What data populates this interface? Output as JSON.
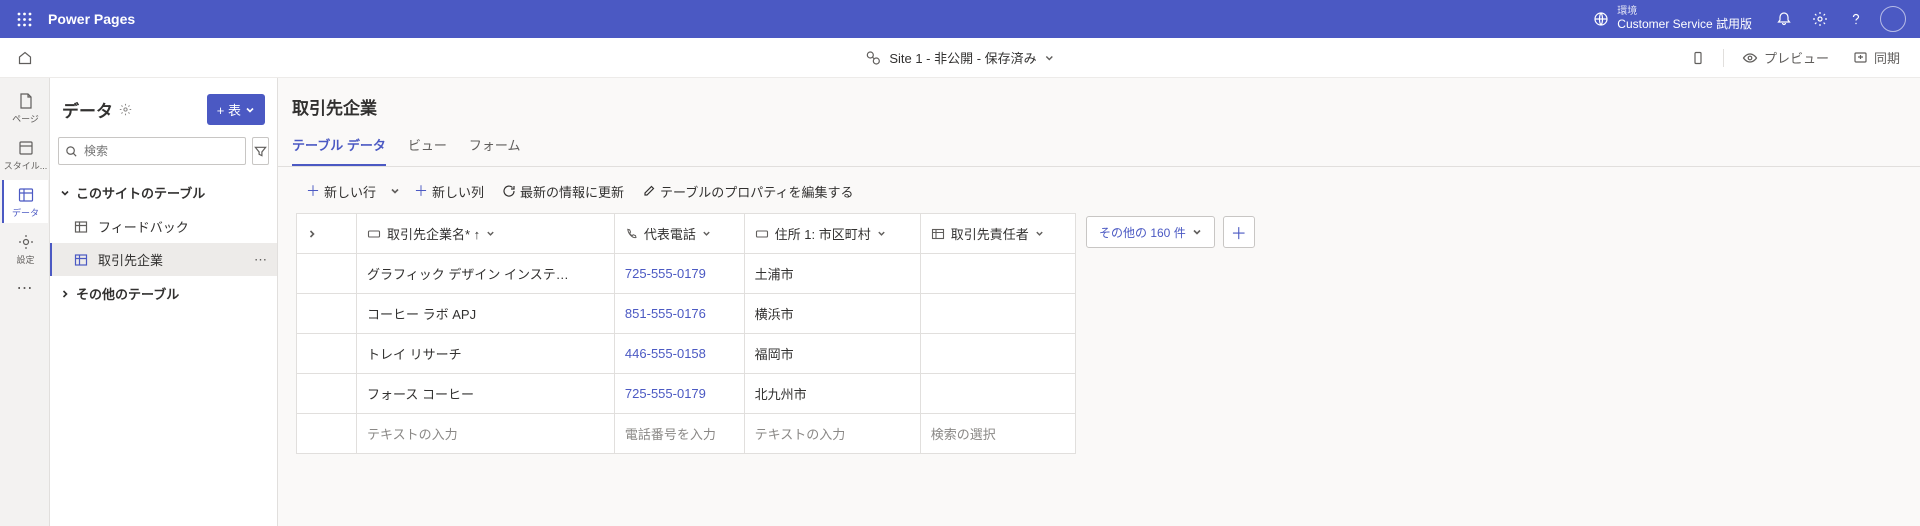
{
  "header": {
    "brand": "Power Pages",
    "env_label": "環境",
    "env_name": "Customer Service 試用版"
  },
  "subheader": {
    "site_status": "Site 1 - 非公開 - 保存済み",
    "preview": "プレビュー",
    "sync": "同期"
  },
  "rail": {
    "page": "ページ",
    "style": "スタイル...",
    "data": "データ",
    "settings": "設定"
  },
  "side": {
    "title": "データ",
    "add_table": "+ 表",
    "search_placeholder": "検索",
    "group1": "このサイトのテーブル",
    "item_feedback": "フィードバック",
    "item_account": "取引先企業",
    "group2": "その他のテーブル"
  },
  "main": {
    "entity_title": "取引先企業",
    "tabs": {
      "data": "テーブル データ",
      "view": "ビュー",
      "form": "フォーム"
    },
    "cmd": {
      "new_row": "新しい行",
      "new_col": "新しい列",
      "refresh": "最新の情報に更新",
      "edit_props": "テーブルのプロパティを編集する"
    },
    "columns": {
      "name": "取引先企業名* ↑",
      "phone": "代表電話",
      "city": "住所 1: 市区町村",
      "owner": "取引先責任者"
    },
    "rows": [
      {
        "name": "グラフィック デザイン インステ…",
        "phone": "725-555-0179",
        "city": "土浦市",
        "owner": ""
      },
      {
        "name": "コーヒー ラボ APJ",
        "phone": "851-555-0176",
        "city": "横浜市",
        "owner": ""
      },
      {
        "name": "トレイ リサーチ",
        "phone": "446-555-0158",
        "city": "福岡市",
        "owner": ""
      },
      {
        "name": "フォース コーヒー",
        "phone": "725-555-0179",
        "city": "北九州市",
        "owner": ""
      }
    ],
    "placeholders": {
      "name": "テキストの入力",
      "phone": "電話番号を入力",
      "city": "テキストの入力",
      "owner": "検索の選択"
    },
    "more_cols": "その他の 160 件"
  }
}
